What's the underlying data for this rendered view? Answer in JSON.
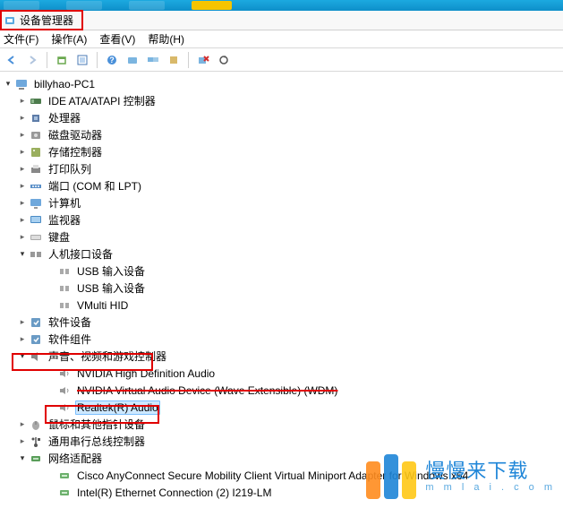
{
  "window": {
    "title": "设备管理器"
  },
  "menu": {
    "file": "文件(F)",
    "action": "操作(A)",
    "view": "查看(V)",
    "help": "帮助(H)"
  },
  "toolbar_icons": [
    "back",
    "forward",
    "up",
    "properties",
    "help",
    "monitor",
    "monitors",
    "devices",
    "delete",
    "refresh"
  ],
  "tree": {
    "root": {
      "label": "billyhao-PC1",
      "expanded": true
    },
    "nodes": [
      {
        "label": "IDE ATA/ATAPI 控制器",
        "icon": "ide",
        "expandable": true
      },
      {
        "label": "处理器",
        "icon": "cpu",
        "expandable": true
      },
      {
        "label": "磁盘驱动器",
        "icon": "disk",
        "expandable": true
      },
      {
        "label": "存储控制器",
        "icon": "storage",
        "expandable": true
      },
      {
        "label": "打印队列",
        "icon": "printer",
        "expandable": true
      },
      {
        "label": "端口 (COM 和 LPT)",
        "icon": "port",
        "expandable": true
      },
      {
        "label": "计算机",
        "icon": "computer",
        "expandable": true
      },
      {
        "label": "监视器",
        "icon": "monitor",
        "expandable": true
      },
      {
        "label": "键盘",
        "icon": "keyboard",
        "expandable": true
      },
      {
        "label": "人机接口设备",
        "icon": "hid",
        "expandable": true,
        "expanded": true,
        "children": [
          {
            "label": "USB 输入设备",
            "icon": "hid-sub"
          },
          {
            "label": "USB 输入设备",
            "icon": "hid-sub"
          },
          {
            "label": "VMulti HID",
            "icon": "hid-sub"
          }
        ]
      },
      {
        "label": "软件设备",
        "icon": "soft",
        "expandable": true
      },
      {
        "label": "软件组件",
        "icon": "soft",
        "expandable": true
      },
      {
        "label": "声音、视频和游戏控制器",
        "icon": "sound",
        "expandable": true,
        "expanded": true,
        "children": [
          {
            "label": "NVIDIA High Definition Audio",
            "icon": "speaker"
          },
          {
            "label": "NVIDIA Virtual Audio Device (Wave Extensible) (WDM)",
            "icon": "speaker",
            "strike": true
          },
          {
            "label": "Realtek(R) Audio",
            "icon": "speaker",
            "selected": true
          }
        ]
      },
      {
        "label": "鼠标和其他指针设备",
        "icon": "mouse",
        "expandable": true
      },
      {
        "label": "通用串行总线控制器",
        "icon": "usb",
        "expandable": true
      },
      {
        "label": "网络适配器",
        "icon": "net",
        "expandable": true,
        "expanded": true,
        "children": [
          {
            "label": "Cisco AnyConnect Secure Mobility Client Virtual Miniport Adapter for Windows x64",
            "icon": "net-sub"
          },
          {
            "label": "Intel(R) Ethernet Connection (2) I219-LM",
            "icon": "net-sub"
          }
        ]
      }
    ]
  },
  "watermark": {
    "line1": "慢慢来下载",
    "line2": "m m l a i . c o m"
  },
  "colors": {
    "highlight": "#e00000",
    "selection": "#cde8ff",
    "brand_orange": "#ff8c1f",
    "brand_blue": "#1f86d8",
    "brand_yellow": "#ffc817"
  }
}
